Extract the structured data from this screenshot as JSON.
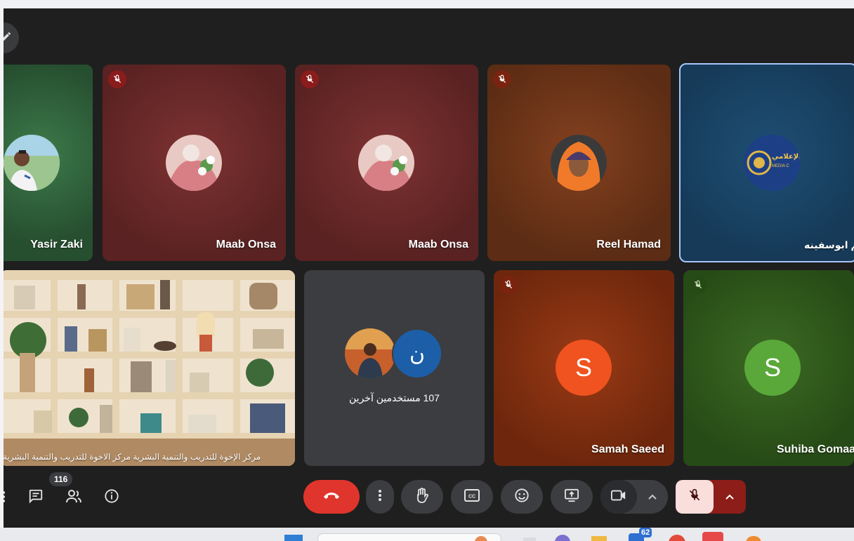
{
  "tiles": [
    {
      "name": "Yasir Zaki",
      "muted": false
    },
    {
      "name": "Maab Onsa",
      "muted": true
    },
    {
      "name": "Maab Onsa",
      "muted": true
    },
    {
      "name": "Reel Hamad",
      "muted": true
    },
    {
      "name": "مريم ابوسفينه",
      "muted": false,
      "logo_text": "الإعلامي",
      "logo_sub": "MEDIA C"
    }
  ],
  "bottom_tiles": {
    "presentation_caption": "مركز الإخوة للتدريب والتنمية البشرية مركز الاخوة للتدريب والتنمية البشرية",
    "others": {
      "letter": "ن",
      "label": "107 مستخدمين آخرين"
    },
    "samah": {
      "letter": "S",
      "name": "Samah Saeed"
    },
    "suhiba": {
      "letter": "S",
      "name": "Suhiba Gomaa"
    }
  },
  "controls": {
    "people_count": "116"
  },
  "taskbar": {
    "badge": "62"
  },
  "colors": {
    "stage_bg": "#1f1f1f",
    "end_call": "#e0352c",
    "mic_muted_bg": "#f9dedc",
    "mic_muted_chevron": "#8c1d18",
    "samah_avatar": "#f0531f",
    "suhiba_avatar": "#5aa83a",
    "others_avatar": "#1d5ea8",
    "highlight_border": "#a8c7fa"
  },
  "icons": [
    "pencil-icon",
    "mic-off-icon",
    "chat-icon",
    "people-icon",
    "info-icon",
    "end-call-icon",
    "more-vert-icon",
    "raise-hand-icon",
    "captions-icon",
    "emoji-icon",
    "present-icon",
    "camera-icon",
    "chevron-up-icon",
    "mic-off-icon"
  ]
}
